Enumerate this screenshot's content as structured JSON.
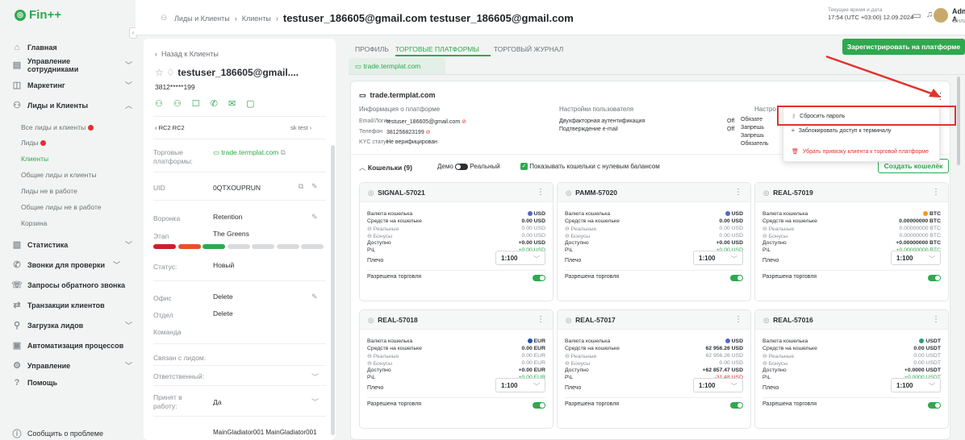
{
  "app": {
    "logo": "Fin++"
  },
  "sidebar": {
    "items": [
      {
        "label": "Главная"
      },
      {
        "label": "Управление сотрудниками"
      },
      {
        "label": "Маркетинг"
      },
      {
        "label": "Лиды и Клиенты"
      },
      {
        "label": "Статистика"
      },
      {
        "label": "Звонки для проверки"
      },
      {
        "label": "Запросы обратного звонка"
      },
      {
        "label": "Транзакции клиентов"
      },
      {
        "label": "Загрузка лидов"
      },
      {
        "label": "Автоматизация процессов"
      },
      {
        "label": "Управление"
      },
      {
        "label": "Помощь"
      }
    ],
    "sub": [
      "Все лиды и клиенты",
      "Лиды",
      "Клиенты",
      "Общие лиды и клиенты",
      "Лиды не в работе",
      "Общие лиды не в работе",
      "Корзина"
    ],
    "report": "Сообщить о проблеме"
  },
  "header": {
    "crumb1": "Лиды и Клиенты",
    "crumb2": "Клиенты",
    "title": "testuser_186605@gmail.com testuser_186605@gmail.com",
    "time_label": "Текущее время и дата",
    "time": "17:54 (UTC +03:00) 12.09.2024",
    "admin": "Admin A",
    "status": "Онлайн"
  },
  "profile": {
    "back": "Назад к Клиенты",
    "name": "testuser_186605@gmail....",
    "phone": "3812*****199",
    "desk": "RC2 RC2",
    "desk_right": "sk test",
    "platforms_label": "Торговые платформы:",
    "platforms_value": "trade.termplat.com",
    "uid_label": "UID",
    "uid": "0QTXOUPRUN",
    "funnel_label": "Воронка",
    "funnel": "Retention",
    "stage_label": "Этап",
    "stage": "The Greens",
    "status_label": "Статус:",
    "status": "Новый",
    "office_label": "Офис",
    "office": "Delete",
    "dept_label": "Отдел",
    "dept": "Delete",
    "team_label": "Команда",
    "linked_label": "Связан с лидом:",
    "resp_label": "Ответственный:",
    "accepted_label": "Принят в работу:",
    "accepted": "Да",
    "last": "MainGladiator001 MainGladiator001",
    "stage_colors": [
      "#c8202b",
      "#e8502a",
      "#2fa84f",
      "#d9dcde",
      "#d9dcde",
      "#d9dcde",
      "#d9dcde"
    ]
  },
  "main": {
    "tabs": [
      "ПРОФИЛЬ",
      "ТОРГОВЫЕ ПЛАТФОРМЫ",
      "ТОРГОВЫЙ ЖУРНАЛ"
    ],
    "subtab": "trade.termplat.com",
    "register": "Зарегистрировать на платформе",
    "platform": {
      "name": "trade.termplat.com",
      "info_title": "Информация о платформе",
      "email_label": "Email/Логин",
      "email": "testuser_186605@gmail.com",
      "phone_label": "Телефон",
      "phone": "381256823199",
      "kyc_label": "KYC статус",
      "kyc": "Не верифицирован",
      "settings_title": "Настройки пользователя",
      "twofa": "Двухфакторная аутентификация",
      "twofa_val": "Off",
      "confirm_email": "Подтверждение e-mail",
      "confirm_val": "Off",
      "settings2_title": "Настро",
      "s2a": "Обязате",
      "s2b": "Запрешь",
      "s2c": "Запрешь",
      "s2d": "Обязатель"
    },
    "wallets_label": "Кошельки (9)",
    "demo": "Демо",
    "real": "Реальный",
    "show_zero": "Показывать кошельки с нулевым балансом",
    "create": "Создать кошелёк",
    "labels": {
      "currency": "Валюта кошелька",
      "funds": "Средств на кошельке",
      "real": "Реальные",
      "bonus": "Бонусы",
      "available": "Доступно",
      "pl": "P\\L",
      "leverage": "Плечо",
      "trading": "Разрешена торговля"
    },
    "dropdown": {
      "reset": "Сбросить пароль",
      "block": "Заблокировать доступ к терминалу",
      "unlink": "Убрать привязку клиента к торговой платформе"
    },
    "wallets": [
      {
        "name": "SIGNAL-57021",
        "cur": "USD",
        "funds": "0.00 USD",
        "real": "0.00 USD",
        "bonus": "0.00 USD",
        "avail": "+0.00 USD",
        "pl": "+0.00 USD",
        "lev": "1:100",
        "curcolor": "#5566c8"
      },
      {
        "name": "PAMM-57020",
        "cur": "USD",
        "funds": "0.00 USD",
        "real": "0.00 USD",
        "bonus": "0.00 USD",
        "avail": "+0.00 USD",
        "pl": "+0.00 USD",
        "lev": "1:100",
        "curcolor": "#5566c8"
      },
      {
        "name": "REAL-57019",
        "cur": "BTC",
        "funds": "0.00000000 BTC",
        "real": "0.00000000 BTC",
        "bonus": "0.00000000 BTC",
        "avail": "+0.00000000 BTC",
        "pl": "+0.00000000 BTC",
        "lev": "1:100",
        "curcolor": "#f29a1a"
      },
      {
        "name": "REAL-57018",
        "cur": "EUR",
        "funds": "0.00 EUR",
        "real": "0.00 EUR",
        "bonus": "0.00 EUR",
        "avail": "+0.00 EUR",
        "pl": "+0.00 EUR",
        "lev": "1:100",
        "curcolor": "#1f4fb5"
      },
      {
        "name": "REAL-57017",
        "cur": "USD",
        "funds": "62 956.26 USD",
        "real": "62 956.26 USD",
        "bonus": "0.00 USD",
        "avail": "+62 857.47 USD",
        "pl": "-31.48 USD",
        "lev": "1:100",
        "curcolor": "#5566c8",
        "neg": true
      },
      {
        "name": "REAL-57016",
        "cur": "USDT",
        "funds": "0.00 USDT",
        "real": "0.00 USDT",
        "bonus": "0.00 USDT",
        "avail": "+0.0000 USDT",
        "pl": "+0.0000 USDT",
        "lev": "1:100",
        "curcolor": "#27a17a"
      }
    ]
  }
}
